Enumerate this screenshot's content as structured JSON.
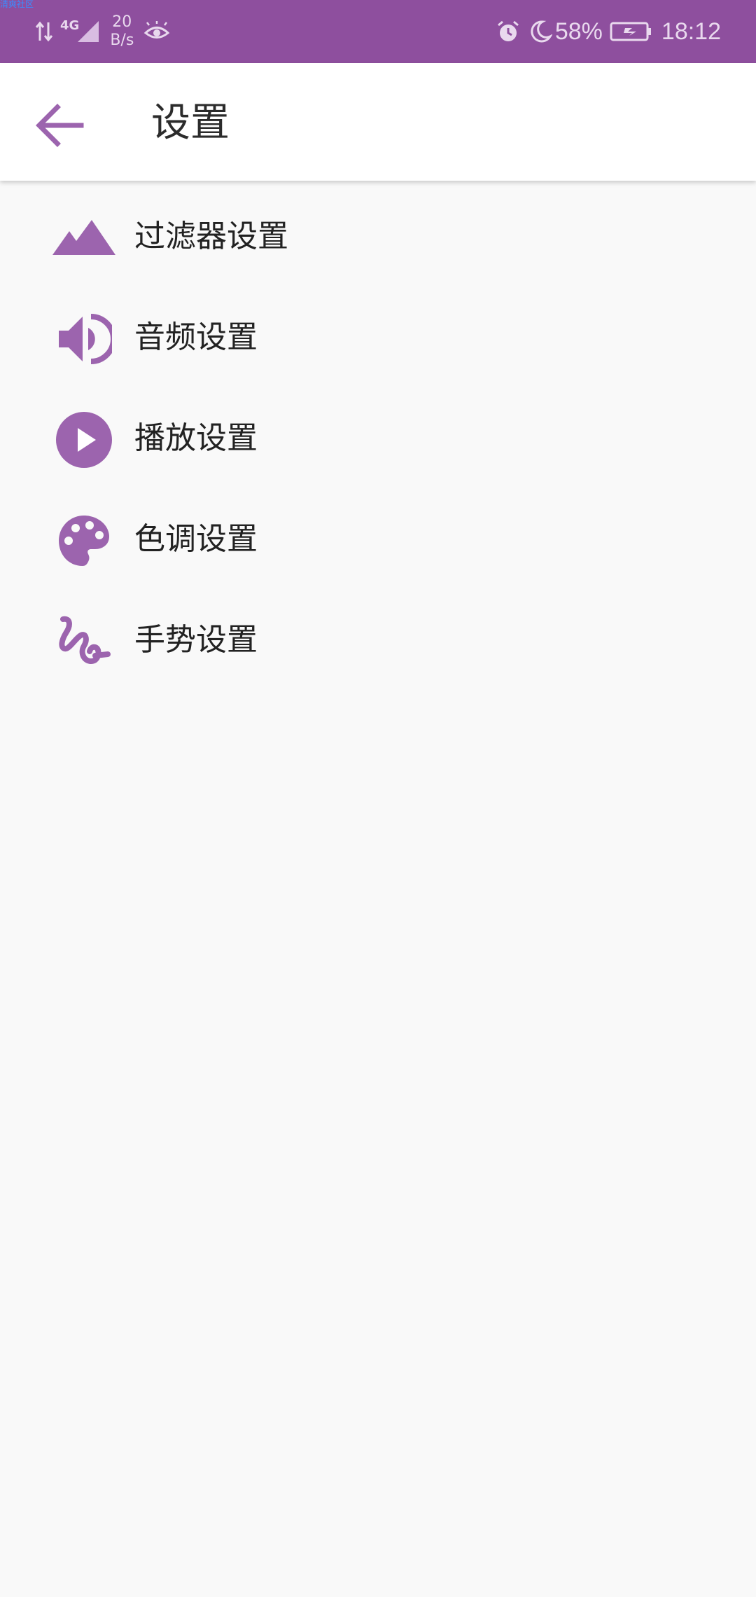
{
  "colors": {
    "status_bar": "#8e4f9e",
    "accent": "#9c64ae",
    "background": "#f9f9f9",
    "app_bar": "#ffffff"
  },
  "status_bar": {
    "watermark": "清爽社区",
    "network_type": "4G",
    "speed_value": "20",
    "speed_unit": "B/s",
    "battery": "58%",
    "time": "18:12",
    "icons_left": [
      "data-arrows-icon",
      "signal-icon",
      "eye-icon"
    ],
    "icons_right": [
      "alarm-icon",
      "moon-icon",
      "battery-icon"
    ]
  },
  "app_bar": {
    "back_icon": "arrow-left-icon",
    "title": "设置"
  },
  "settings": [
    {
      "id": "filter",
      "label": "过滤器设置",
      "icon": "mountain-icon"
    },
    {
      "id": "audio",
      "label": "音频设置",
      "icon": "volume-icon"
    },
    {
      "id": "playback",
      "label": "播放设置",
      "icon": "play-circle-icon"
    },
    {
      "id": "color",
      "label": "色调设置",
      "icon": "palette-icon"
    },
    {
      "id": "gesture",
      "label": "手势设置",
      "icon": "gesture-icon"
    }
  ]
}
